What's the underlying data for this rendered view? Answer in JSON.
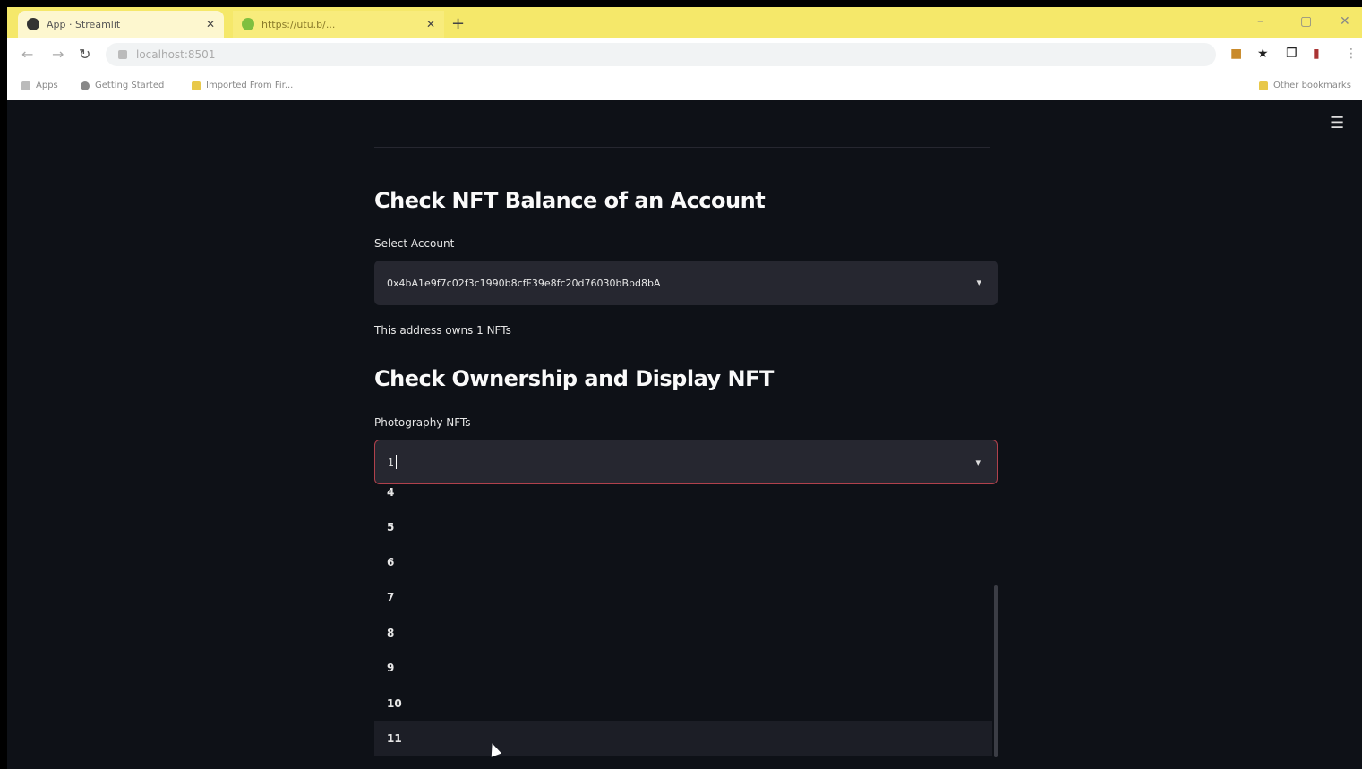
{
  "browser": {
    "tabs": [
      {
        "title": "App · Streamlit",
        "active": false
      },
      {
        "title": "https://utu.b/...",
        "active": true
      }
    ],
    "new_tab_label": "+",
    "address": "localhost:8501",
    "bookmarks": [
      "Apps",
      "Getting Started",
      "Imported From Fir..."
    ],
    "other_bookmarks": "Other bookmarks",
    "window_controls": [
      "–",
      "▢",
      "✕"
    ]
  },
  "app": {
    "menu_icon": "☰",
    "section1": {
      "title": "Check NFT Balance of an Account",
      "select_label": "Select Account",
      "select_value": "0x4bA1e9f7c02f3c1990b8cfF39e8fc20d76030bBbd8bA"
    },
    "balance_text": "This address owns 1 NFTs",
    "section2": {
      "title": "Check Ownership and Display NFT",
      "select_label": "Photography NFTs",
      "select_value": "1"
    },
    "dropdown_options": [
      "4",
      "5",
      "6",
      "7",
      "8",
      "9",
      "10",
      "11"
    ],
    "hovered_option": "11"
  },
  "colors": {
    "background": "#0e1117",
    "input_bg": "#262730",
    "focus_border": "#b0414c",
    "text": "#fafafa"
  }
}
